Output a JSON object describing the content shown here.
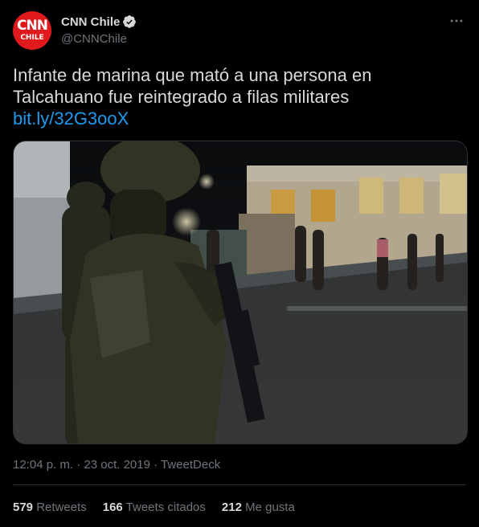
{
  "account": {
    "display_name": "CNN Chile",
    "handle": "@CNNChile",
    "verified": true,
    "avatar": {
      "line1": "CNN",
      "line2": "CHILE",
      "background": "#e0191c"
    }
  },
  "tweet": {
    "text_line1": "Infante de marina que mató a una persona en",
    "text_line2": "Talcahuano fue reintegrado a filas militares",
    "link": "bit.ly/32G3ooX"
  },
  "meta": {
    "time": "12:04 p. m.",
    "separator1": " · ",
    "date": "23 oct. 2019",
    "separator2": " · ",
    "app": "TweetDeck"
  },
  "stats": {
    "retweets_count": "579",
    "retweets_label": "Retweets",
    "quotes_count": "166",
    "quotes_label": "Tweets citados",
    "likes_count": "212",
    "likes_label": "Me gusta"
  },
  "colors": {
    "background": "#000000",
    "text": "#d9d9d9",
    "secondary": "#6e767d",
    "link": "#1d9bf0",
    "verified": "#d9d9d9",
    "divider": "#2f3336"
  },
  "icons": {
    "verified": "verified-badge-icon",
    "more": "more-options-icon"
  }
}
